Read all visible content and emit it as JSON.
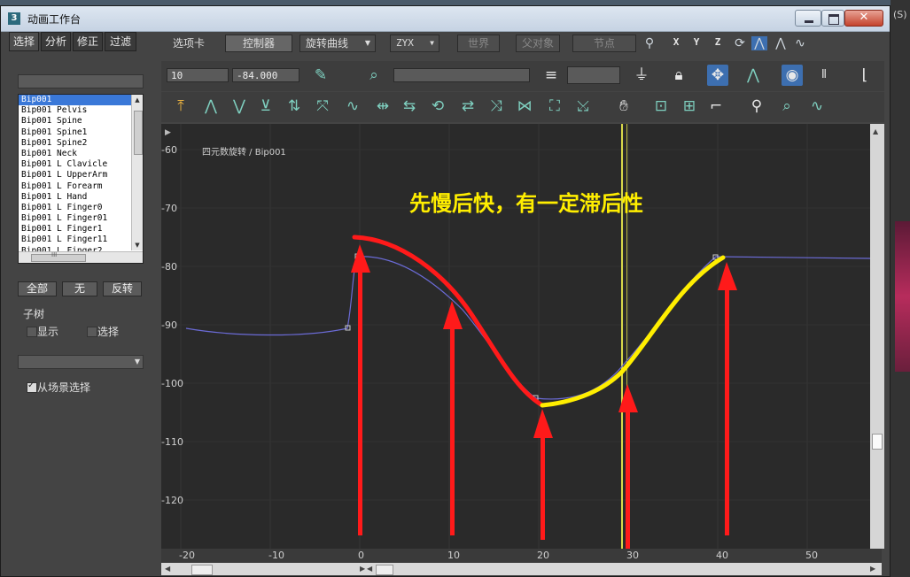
{
  "window": {
    "title": "动画工作台",
    "icon_label": "3"
  },
  "left_panel": {
    "tabs": [
      "选择",
      "分析",
      "修正",
      "过滤"
    ],
    "bones": [
      "Bip001",
      "Bip001 Pelvis",
      "Bip001 Spine",
      "Bip001 Spine1",
      "Bip001 Spine2",
      "Bip001 Neck",
      "Bip001 L Clavicle",
      "Bip001 L UpperArm",
      "Bip001 L Forearm",
      "Bip001 L Hand",
      "Bip001 L Finger0",
      "Bip001 L Finger01",
      "Bip001 L Finger1",
      "Bip001 L Finger11",
      "Bip001 L Finger2"
    ],
    "selected_bone": "Bip001",
    "hscroll_marker": "III",
    "btn_all": "全部",
    "btn_none": "无",
    "btn_invert": "反转",
    "subtree_label": "子树",
    "show_label": "显示",
    "select_label": "选择",
    "from_scene_label": "从场景选择",
    "from_scene_checked": true
  },
  "top_bar": {
    "options_tab": "选项卡",
    "controller_button": "控制器",
    "rotation_dropdown": "旋转曲线",
    "order_dropdown": "ZYX",
    "world_button": "世界",
    "parent_button": "父对象",
    "node_button": "节点",
    "axes": [
      "X",
      "Y",
      "Z"
    ]
  },
  "toolbar": {
    "frame_value": "10",
    "value_field": "-84.000",
    "icons_row1": [
      "key-info-icon",
      "zoom-key-icon",
      "filter-list-icon",
      "filter-icon",
      "lock-icon",
      "move-keys-icon",
      "tangent-icon",
      "show-curve-icon",
      "waveform-icon",
      "axis-icon"
    ],
    "icons_row2": [
      "add-key-icon",
      "tangent-auto-icon",
      "tangent-fast-icon",
      "tangent-slow-icon",
      "tangent-step-icon",
      "scale-keys-icon",
      "smooth-icon",
      "align-icon",
      "swap-icon",
      "loop-icon",
      "copy-icon",
      "mirror-icon",
      "select-all-icon",
      "pan-icon",
      "hand-icon",
      "snap-icon",
      "frame-icon",
      "zoom-extents-icon",
      "zoom-icon",
      "zoom-region-icon",
      "zoom-fit-icon"
    ]
  },
  "graph": {
    "curve_label": "四元数旋转 / Bip001",
    "annotation": "先慢后快，有一定滞后性",
    "y_ticks": [
      "-60",
      "-70",
      "-80",
      "-90",
      "-100",
      "-110",
      "-120"
    ],
    "x_ticks": [
      "-20",
      "-10",
      "0",
      "10",
      "20",
      "30",
      "40",
      "50"
    ],
    "current_frame": 29,
    "colors": {
      "highlight_red": "#ff1a1a",
      "highlight_yellow": "#ffee00",
      "curve_blue": "#6b6bd6",
      "time_bar": "#d8d84a"
    }
  },
  "right_edge": {
    "label": "(S)"
  }
}
